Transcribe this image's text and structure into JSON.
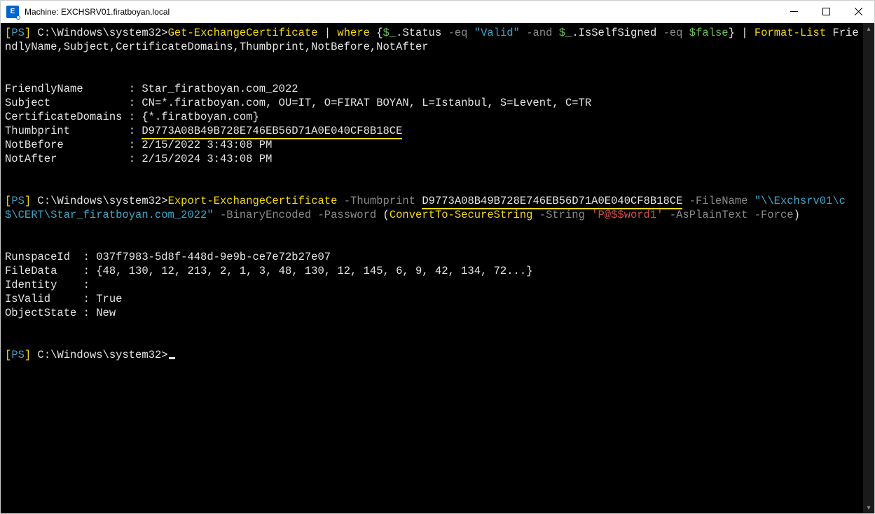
{
  "window": {
    "title": "Machine: EXCHSRV01.firatboyan.local",
    "icon_letter": "E"
  },
  "prompt": {
    "bracket_open": "[",
    "ps": "PS",
    "bracket_close": "]",
    "path": " C:\\Windows\\system32>"
  },
  "cmd1": {
    "name": "Get-ExchangeCertificate",
    "pipe1": " | ",
    "where": "where",
    "brace_open": " {",
    "dollar_under1": "$_",
    "dot_status": ".Status ",
    "eq1": "-eq ",
    "valid": "\"Valid\"",
    "and": " -and ",
    "dollar_under2": "$_",
    "dot_iss": ".IsSelfSigned ",
    "eq2": "-eq ",
    "false": "$false",
    "brace_close": "}",
    "pipe2": " | ",
    "fmt": "Format-List",
    "fields": " FriendlyName,Subject,CertificateDomains,Thumbprint,NotBefore,NotAfter"
  },
  "out1": {
    "friendly_label": "FriendlyName       : ",
    "friendly_value": "Star_firatboyan.com_2022",
    "subject_label": "Subject            : ",
    "subject_value": "CN=*.firatboyan.com, OU=IT, O=FIRAT BOYAN, L=Istanbul, S=Levent, C=TR",
    "domains_label": "CertificateDomains : ",
    "domains_value": "{*.firatboyan.com}",
    "thumb_label": "Thumbprint         : ",
    "thumb_value": "D9773A08B49B728E746EB56D71A0E040CF8B18CE",
    "notbefore_label": "NotBefore          : ",
    "notbefore_value": "2/15/2022 3:43:08 PM",
    "notafter_label": "NotAfter           : ",
    "notafter_value": "2/15/2024 3:43:08 PM"
  },
  "cmd2": {
    "name": "Export-ExchangeCertificate",
    "p_thumb": " -Thumbprint ",
    "thumb": "D9773A08B49B728E746EB56D71A0E040CF8B18CE",
    "p_file": " -FileName ",
    "file": "\"\\\\Exchsrv01\\c$\\CERT\\Star_firatboyan.com_2022\"",
    "p_bin": " -BinaryEncoded",
    "p_pass": " -Password ",
    "paren_open": "(",
    "convert": "ConvertTo-SecureString",
    "p_str": " -String ",
    "pw": "'P@$$word1'",
    "p_plain": " -AsPlainText",
    "p_force": " -Force",
    "paren_close": ")"
  },
  "out2": {
    "runspace_label": "RunspaceId  : ",
    "runspace_value": "037f7983-5d8f-448d-9e9b-ce7e72b27e07",
    "filedata_label": "FileData    : ",
    "filedata_value": "{48, 130, 12, 213, 2, 1, 3, 48, 130, 12, 145, 6, 9, 42, 134, 72...}",
    "identity_label": "Identity    :",
    "isvalid_label": "IsValid     : ",
    "isvalid_value": "True",
    "objstate_label": "ObjectState : ",
    "objstate_value": "New"
  }
}
